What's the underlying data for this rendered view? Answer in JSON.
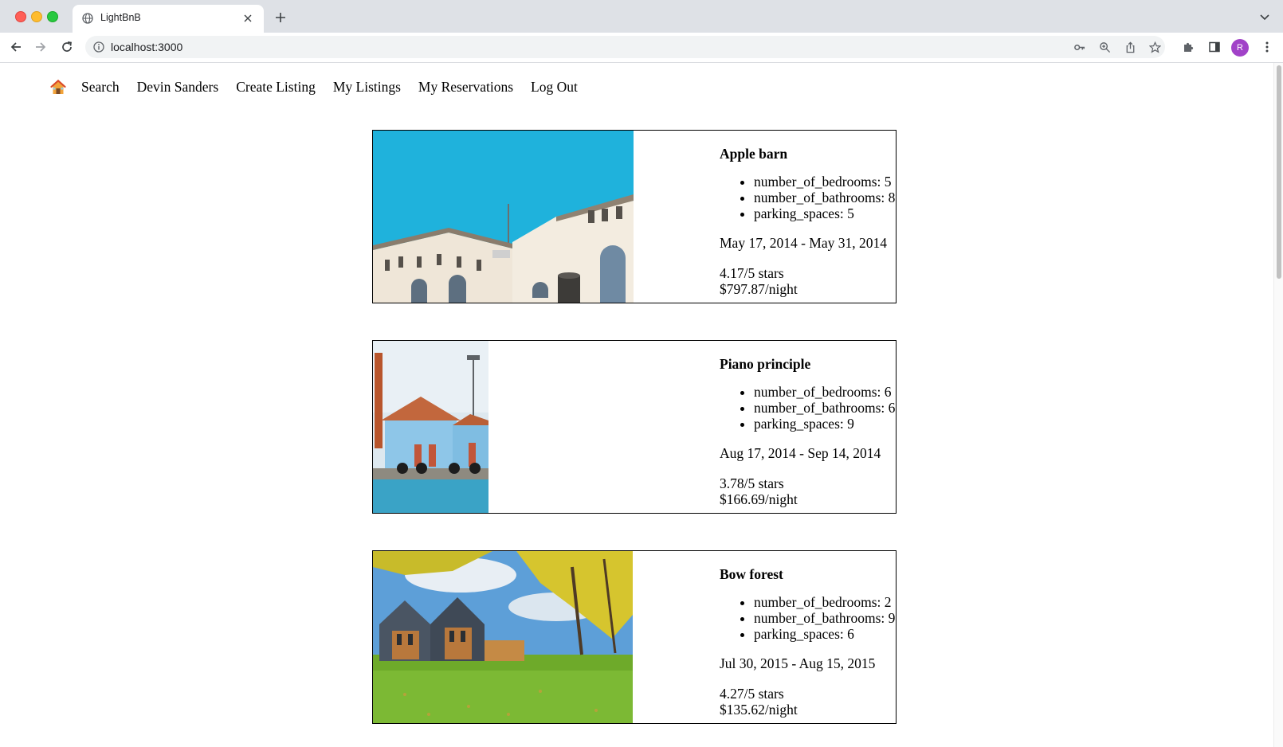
{
  "browser": {
    "tab_title": "LightBnB",
    "url": "localhost:3000",
    "profile_initial": "R"
  },
  "nav": {
    "home_icon": "house-emoji",
    "links": [
      "Search",
      "Devin Sanders",
      "Create Listing",
      "My Listings",
      "My Reservations",
      "Log Out"
    ]
  },
  "reservations": [
    {
      "title": "Apple barn",
      "details": [
        "number_of_bedrooms: 5",
        "number_of_bathrooms: 8",
        "parking_spaces: 5"
      ],
      "dates": "May 17, 2014 - May 31, 2014",
      "rating": "4.17/5 stars",
      "price": "$797.87/night",
      "photo": "white historic building with arched windows under blue sky"
    },
    {
      "title": "Piano principle",
      "details": [
        "number_of_bedrooms: 6",
        "number_of_bathrooms: 6",
        "parking_spaces: 9"
      ],
      "dates": "Aug 17, 2014 - Sep 14, 2014",
      "rating": "3.78/5 stars",
      "price": "$166.69/night",
      "photo": "light blue waterfront building with tire bumpers"
    },
    {
      "title": "Bow forest",
      "details": [
        "number_of_bedrooms: 2",
        "number_of_bathrooms: 9",
        "parking_spaces: 6"
      ],
      "dates": "Jul 30, 2015 - Aug 15, 2015",
      "rating": "4.27/5 stars",
      "price": "$135.62/night",
      "photo": "modern gabled houses on green lawn under autumn trees"
    }
  ],
  "colors": {
    "tabstrip": "#dee1e6",
    "omnibox": "#f1f3f4",
    "avatar": "#a142c8",
    "card_border": "#000000"
  }
}
